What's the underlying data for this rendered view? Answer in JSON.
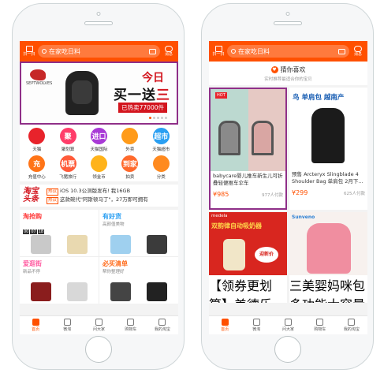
{
  "left": {
    "scan_label": "扫一扫",
    "search_placeholder": "在家吃日料",
    "msg_label": "消息",
    "banner": {
      "brand": "SEPTWOLVES",
      "today": "今日",
      "bogo_main": "买一送",
      "bogo_accent": "三",
      "hot": "已热卖77000件"
    },
    "grid": [
      {
        "label": "天猫",
        "glyph": "",
        "color": "#e8232b"
      },
      {
        "label": "聚划算",
        "glyph": "聚",
        "color": "#ff3d6a"
      },
      {
        "label": "天猫国际",
        "glyph": "进口",
        "color": "#a83ad6"
      },
      {
        "label": "外卖",
        "glyph": "",
        "color": "#ff9b1a"
      },
      {
        "label": "天猫超市",
        "glyph": "超市",
        "color": "#2a9ff2"
      },
      {
        "label": "充值中心",
        "glyph": "充",
        "color": "#ff7417"
      },
      {
        "label": "飞猪旅行",
        "glyph": "机票",
        "color": "#ff5b3a"
      },
      {
        "label": "领金币",
        "glyph": "",
        "color": "#ffb31a"
      },
      {
        "label": "拍卖",
        "glyph": "到家",
        "color": "#ff6a2c"
      },
      {
        "label": "分类",
        "glyph": "",
        "color": "#ff8a1f"
      }
    ],
    "headline": {
      "logo_top": "淘宝",
      "logo_bottom": "头条",
      "tag": "热议",
      "line1": "iOS 10.3公测版发布! 我16GB",
      "line2": "这款碗代\"阿斯顿马丁\"，27万即可拥有"
    },
    "promos": [
      {
        "title": "淘抢购",
        "sub": "",
        "timer": [
          "00",
          "07",
          "18"
        ],
        "accent": "#ff3d3d"
      },
      {
        "title": "有好货",
        "sub": "高颜值美物",
        "timer": [],
        "accent": "#2a9ff2"
      },
      {
        "title": "爱逛街",
        "sub": "新品不停",
        "timer": [],
        "accent": "#ff5aa0"
      },
      {
        "title": "必买清单",
        "sub": "帮你整理好",
        "timer": [],
        "accent": "#ff6b1a"
      }
    ],
    "tabs": [
      {
        "label": "首页"
      },
      {
        "label": "微淘"
      },
      {
        "label": "问大家"
      },
      {
        "label": "购物车"
      },
      {
        "label": "我的淘宝"
      }
    ]
  },
  "right": {
    "scan_label": "扫一扫",
    "search_placeholder": "在家吃日料",
    "msg_label": "消息",
    "guess_title": "猜你喜欢",
    "guess_sub": "实时推荐最适合你的宝贝",
    "cards": [
      {
        "badge": "HOT",
        "title": "babycare婴儿推车新生儿可折叠轻便推车伞车",
        "price": "¥985",
        "paid": "977人付款"
      },
      {
        "badge": "",
        "title": "预售 Arcteryx Slingblade 4 Shoulder Bag 单肩包 2月下...",
        "price": "¥299",
        "paid": "625人付款",
        "overlay": "鸟 单肩包 越南产"
      },
      {
        "badge": "",
        "title": "【领券更划算】美德乐 Medela swing自动吸奶器单...",
        "price": "",
        "paid": "",
        "overlay": "双韵律自动吸奶器",
        "brand": "medela",
        "promo": "迎新价 1099"
      },
      {
        "badge": "",
        "title": "三美婴妈咪包多功能大容量妈咪包双肩外出背包妈...",
        "price": "",
        "paid": "",
        "brand": "Sunveno"
      }
    ],
    "tabs": [
      {
        "label": "首页"
      },
      {
        "label": "微淘"
      },
      {
        "label": "问大家"
      },
      {
        "label": "购物车"
      },
      {
        "label": "我的淘宝"
      }
    ]
  },
  "colors": {
    "brand": "#ff5000",
    "highlight": "#8f2f88"
  }
}
